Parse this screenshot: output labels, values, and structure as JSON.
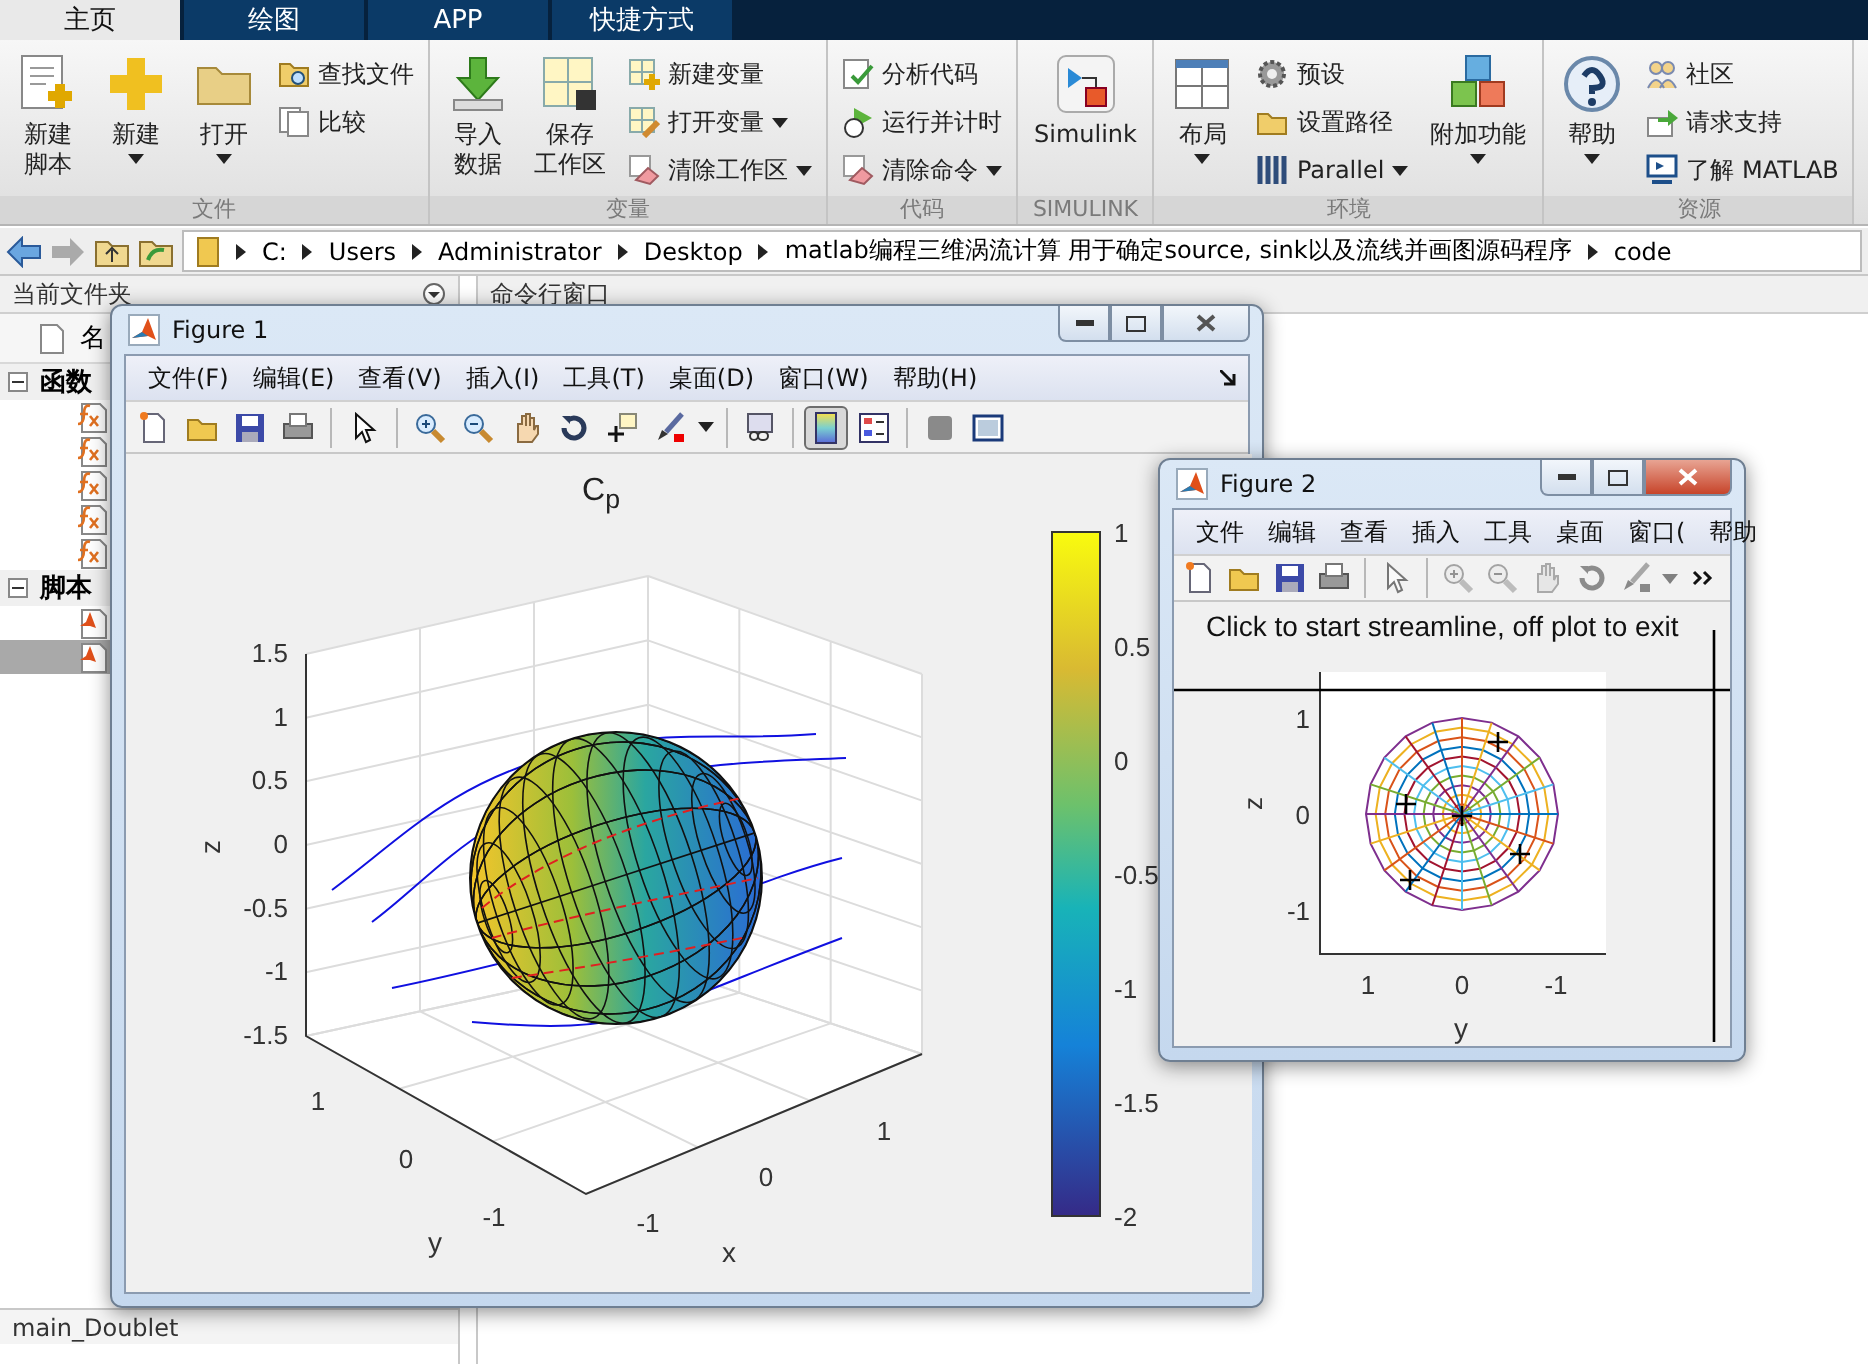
{
  "ribbon": {
    "tabs": [
      {
        "label": "主页",
        "selected": true
      },
      {
        "label": "绘图",
        "selected": false
      },
      {
        "label": "APP",
        "selected": false
      },
      {
        "label": "快捷方式",
        "selected": false
      }
    ],
    "groups": [
      {
        "label": "文件",
        "items": [
          {
            "kind": "large",
            "lines": [
              "新建",
              "脚本"
            ],
            "dropdown": false
          },
          {
            "kind": "large",
            "lines": [
              "新建"
            ],
            "dropdown": true
          },
          {
            "kind": "large",
            "lines": [
              "打开"
            ],
            "dropdown": true
          },
          {
            "kind": "column",
            "items": [
              {
                "label": "查找文件",
                "dropdown": false
              },
              {
                "label": "比较",
                "dropdown": false
              }
            ]
          }
        ]
      },
      {
        "label": "变量",
        "items": [
          {
            "kind": "large",
            "lines": [
              "导入",
              "数据"
            ],
            "dropdown": false
          },
          {
            "kind": "large",
            "lines": [
              "保存",
              "工作区"
            ],
            "dropdown": false
          },
          {
            "kind": "column",
            "items": [
              {
                "label": "新建变量",
                "dropdown": false
              },
              {
                "label": "打开变量",
                "dropdown": true
              },
              {
                "label": "清除工作区",
                "dropdown": true
              }
            ]
          }
        ]
      },
      {
        "label": "代码",
        "items": [
          {
            "kind": "column",
            "items": [
              {
                "label": "分析代码",
                "dropdown": false
              },
              {
                "label": "运行并计时",
                "dropdown": false
              },
              {
                "label": "清除命令",
                "dropdown": true
              }
            ]
          }
        ]
      },
      {
        "label": "SIMULINK",
        "items": [
          {
            "kind": "large",
            "lines": [
              "Simulink"
            ],
            "dropdown": false
          }
        ]
      },
      {
        "label": "环境",
        "items": [
          {
            "kind": "large",
            "lines": [
              "布局"
            ],
            "dropdown": true
          },
          {
            "kind": "column",
            "items": [
              {
                "label": "预设",
                "dropdown": false
              },
              {
                "label": "设置路径",
                "dropdown": false
              },
              {
                "label": "Parallel",
                "dropdown": true
              }
            ]
          },
          {
            "kind": "large",
            "lines": [
              "附加功能"
            ],
            "dropdown": true
          }
        ]
      },
      {
        "label": "资源",
        "items": [
          {
            "kind": "large",
            "lines": [
              "帮助"
            ],
            "dropdown": true
          },
          {
            "kind": "column",
            "items": [
              {
                "label": "社区",
                "dropdown": false
              },
              {
                "label": "请求支持",
                "dropdown": false
              },
              {
                "label": "了解 MATLAB",
                "dropdown": false
              }
            ]
          }
        ]
      }
    ]
  },
  "address_bar": {
    "segments": [
      "C:",
      "Users",
      "Administrator",
      "Desktop",
      "matlab编程三维涡流计算 用于确定source, sink以及流线并画图源码程序",
      "code"
    ]
  },
  "current_folder": {
    "title": "当前文件夹",
    "column_header": "名",
    "groups": [
      {
        "label": "函数",
        "expanded": true,
        "files": [
          {
            "kind": "function",
            "selected": false
          },
          {
            "kind": "function",
            "selected": false
          },
          {
            "kind": "function",
            "selected": false
          },
          {
            "kind": "function",
            "selected": false
          },
          {
            "kind": "function",
            "selected": false
          }
        ]
      },
      {
        "label": "脚本",
        "expanded": true,
        "files": [
          {
            "kind": "script",
            "selected": false
          },
          {
            "kind": "script",
            "selected": true
          }
        ]
      }
    ],
    "details": "main_Doublet"
  },
  "command_window": {
    "title": "命令行窗口"
  },
  "figure_1": {
    "title": "Figure 1",
    "menu": [
      "文件(F)",
      "编辑(E)",
      "查看(V)",
      "插入(I)",
      "工具(T)",
      "桌面(D)",
      "窗口(W)",
      "帮助(H)"
    ],
    "toolbar": [
      {
        "kind": "button",
        "pressed": false
      },
      {
        "kind": "button",
        "pressed": false
      },
      {
        "kind": "button",
        "pressed": false
      },
      {
        "kind": "button",
        "pressed": false
      },
      {
        "kind": "separator"
      },
      {
        "kind": "button",
        "pressed": false
      },
      {
        "kind": "separator"
      },
      {
        "kind": "button",
        "pressed": false
      },
      {
        "kind": "button",
        "pressed": false
      },
      {
        "kind": "button",
        "pressed": false
      },
      {
        "kind": "button",
        "pressed": false
      },
      {
        "kind": "button",
        "pressed": false
      },
      {
        "kind": "button",
        "pressed": false
      },
      {
        "kind": "caret"
      },
      {
        "kind": "separator"
      },
      {
        "kind": "button",
        "pressed": false
      },
      {
        "kind": "separator"
      },
      {
        "kind": "button",
        "pressed": true
      },
      {
        "kind": "button",
        "pressed": false
      },
      {
        "kind": "separator"
      },
      {
        "kind": "button",
        "pressed": false
      },
      {
        "kind": "button",
        "pressed": false
      }
    ],
    "plot": {
      "title": "C$_{p}$",
      "z_ticks": [
        "1.5",
        "1",
        "0.5",
        "0",
        "-0.5",
        "-1",
        "-1.5"
      ],
      "y_ticks": [
        "1",
        "0",
        "-1"
      ],
      "x_ticks": [
        "-1",
        "0",
        "1"
      ],
      "xlabel": "x",
      "ylabel": "y",
      "zlabel": "z",
      "colorbar_ticks": [
        "1",
        "0.5",
        "0",
        "-0.5",
        "-1",
        "-1.5",
        "-2"
      ]
    }
  },
  "figure_2": {
    "title": "Figure 2",
    "menu": [
      "文件",
      "编辑",
      "查看",
      "插入",
      "工具",
      "桌面",
      "窗口(",
      "帮助"
    ],
    "toolbar": [
      {
        "kind": "button",
        "disabled": false
      },
      {
        "kind": "button",
        "disabled": false
      },
      {
        "kind": "button",
        "disabled": false
      },
      {
        "kind": "button",
        "disabled": false
      },
      {
        "kind": "separator"
      },
      {
        "kind": "button",
        "disabled": true
      },
      {
        "kind": "separator"
      },
      {
        "kind": "button",
        "disabled": true
      },
      {
        "kind": "button",
        "disabled": true
      },
      {
        "kind": "button",
        "disabled": true
      },
      {
        "kind": "button",
        "disabled": true
      },
      {
        "kind": "button",
        "disabled": true
      },
      {
        "kind": "caret",
        "disabled": true
      },
      {
        "kind": "overflow",
        "disabled": false
      }
    ],
    "prompt": "Click to start streamline, off plot to exit",
    "plot": {
      "z_ticks": [
        "1",
        "0",
        "-1"
      ],
      "y_ticks": [
        "1",
        "0",
        "-1"
      ],
      "xlabel": "y",
      "zlabel": "z"
    }
  }
}
